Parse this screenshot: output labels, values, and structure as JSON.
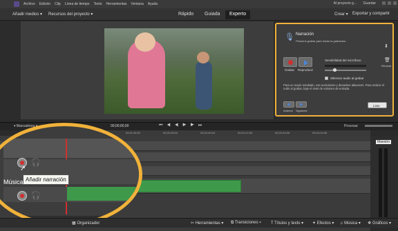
{
  "menu": {
    "items": [
      "Archivo",
      "Edición",
      "Clip",
      "Línea de tiempo",
      "Texto",
      "Herramientas",
      "Ventana",
      "Ayuda"
    ],
    "project": "Al proyecto g...",
    "save": "Guardar"
  },
  "toolbar": {
    "add_media": "Añadir medios",
    "project_assets": "Recursos del proyecto",
    "modes": [
      "Rápido",
      "Guiada",
      "Experto"
    ],
    "create": "Crear",
    "export": "Exportar y compartir"
  },
  "narration": {
    "title": "Narración",
    "hint": "Presione grabar para iniciar la grabación.",
    "mic_sensitivity": "Sensibilidad del micrófono",
    "record": "Grabar",
    "play": "Reproducir",
    "delete": "Eliminar",
    "silence": "Silenciar audio al grabar",
    "note": "Para un mejor resultado, use auriculares y desactive altavoces. Para reducir el ruido al grabar, baje el nivel de volumen de entrada.",
    "prev": "Anterior",
    "next": "Siguiente",
    "done": "Listo"
  },
  "timeline": {
    "markers": "Marcadores",
    "timecode": "00;00;00;00",
    "render": "Procesar",
    "ruler": [
      "00;00",
      "00;04;02",
      "00;01;36;02",
      "00;02;08;04",
      "00;02;40;04",
      "00;03;12;06",
      "00;03;44;06",
      "00;04;16;08"
    ],
    "music_label": "Música",
    "tooltip": "Añadir narración",
    "master": "Maestro"
  },
  "bottombar": {
    "organizer": "Organizador",
    "tools": "Herramientas",
    "transitions": "Transiciones",
    "titles": "Títulos y texto",
    "effects": "Efectos",
    "music": "Música",
    "graphics": "Gráficos"
  },
  "colors": {
    "highlight": "#f1b23a",
    "audio_clip": "#3e9a4a"
  }
}
